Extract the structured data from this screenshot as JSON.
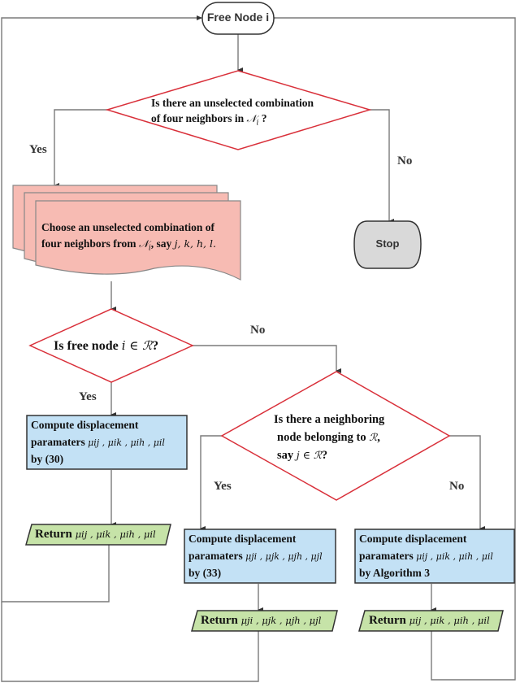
{
  "nodes": {
    "start": {
      "label": "Free Node i"
    },
    "decision_combination": {
      "line1": "Is there an unselected combination",
      "line2_text": "of four neighbors in ",
      "line2_math": "𝒩",
      "line2_sub": "i",
      "line2_end": " ?"
    },
    "stop": {
      "label": "Stop"
    },
    "choose_combination": {
      "line1": "Choose an unselected combination of",
      "line2_text": "four neighbors from ",
      "line2_math": "𝒩",
      "line2_sub": "i",
      "line2_end": ",  say ",
      "line2_vars": "j, k, h, l."
    },
    "decision_free_node": {
      "text": "Is free node ",
      "math": "i ∈ ℛ",
      "end": "?"
    },
    "decision_neighbor": {
      "line1": "Is there a neighboring",
      "line2_text": "node belonging to ",
      "line2_math": "ℛ",
      "line2_end": ",",
      "line3_text": "say ",
      "line3_math": "j ∈ ℛ",
      "line3_end": "?"
    },
    "compute_30": {
      "line1": "Compute displacement",
      "line2_text": "paramaters ",
      "line2_math": "μij , μik , μih , μil",
      "line3": "by (30)"
    },
    "compute_33": {
      "line1": "Compute displacement",
      "line2_text": "paramaters ",
      "line2_math": "μji , μjk , μjh , μjl",
      "line3": "by (33)"
    },
    "compute_alg3": {
      "line1": "Compute displacement",
      "line2_text": "paramaters ",
      "line2_math": "μij , μik , μih , μil",
      "line3": "by Algorithm 3"
    },
    "return_left": {
      "text": "Return ",
      "math": "μij , μik , μih , μil"
    },
    "return_middle": {
      "text": "Return ",
      "math": "μji , μjk , μjh , μjl"
    },
    "return_right": {
      "text": "Return ",
      "math": "μij , μik , μih , μil"
    }
  },
  "edge_labels": {
    "combination_yes": "Yes",
    "combination_no": "No",
    "free_node_no": "No",
    "free_node_yes": "Yes",
    "neighbor_yes": "Yes",
    "neighbor_no": "No"
  },
  "colors": {
    "decision_stroke": "#d9303a",
    "document_fill": "#f7bbb3",
    "process_fill": "#c3e1f5",
    "io_fill": "#c6e3a8",
    "terminal_fill": "#d9d9d9",
    "line": "#777777"
  }
}
